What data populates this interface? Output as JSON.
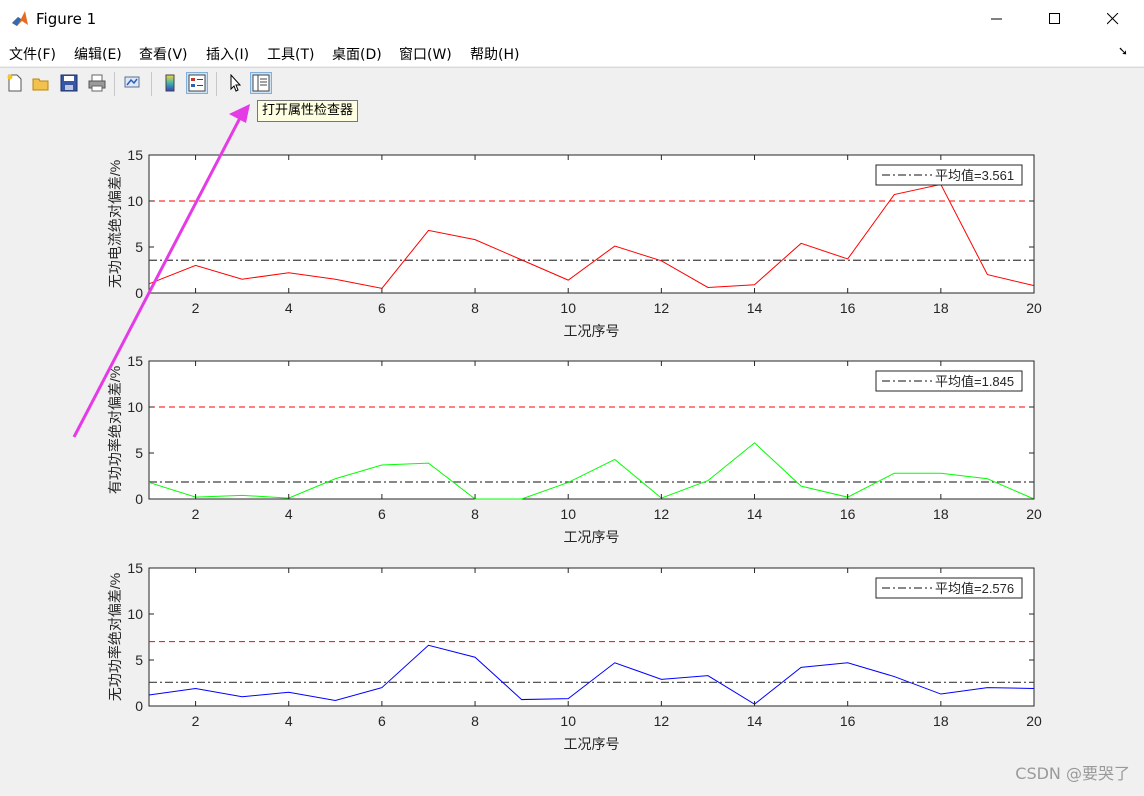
{
  "window": {
    "title": "Figure 1"
  },
  "menus": [
    "文件(F)",
    "编辑(E)",
    "查看(V)",
    "插入(I)",
    "工具(T)",
    "桌面(D)",
    "窗口(W)",
    "帮助(H)"
  ],
  "toolbar": {
    "buttons": [
      "new-figure-icon",
      "open-file-icon",
      "save-icon",
      "print-icon",
      "link-plot-icon",
      "colorbar-icon",
      "legend-icon",
      "pointer-icon",
      "property-inspector-icon"
    ],
    "tooltip": "打开属性检查器"
  },
  "watermark": "CSDN @要哭了",
  "colors": {
    "threshold": "#ff0000",
    "mean": "#404040"
  },
  "chart_data": [
    {
      "type": "line",
      "x": [
        1,
        2,
        3,
        4,
        5,
        6,
        7,
        8,
        9,
        10,
        11,
        12,
        13,
        14,
        15,
        16,
        17,
        18,
        19,
        20
      ],
      "series": [
        {
          "values": [
            1.0,
            3.0,
            1.5,
            2.2,
            1.5,
            0.5,
            6.8,
            5.8,
            3.6,
            1.4,
            5.1,
            3.5,
            0.6,
            0.9,
            5.4,
            3.7,
            10.7,
            11.8,
            2.0,
            0.8
          ],
          "color": "#ff0000"
        }
      ],
      "threshold": 10,
      "mean": 3.561,
      "legend": "平均值=3.561",
      "xlabel": "工况序号",
      "ylabel": "无功电流绝对偏差/%",
      "xlim": [
        1,
        20
      ],
      "ylim": [
        0,
        15
      ],
      "xticks": [
        2,
        4,
        6,
        8,
        10,
        12,
        14,
        16,
        18,
        20
      ],
      "yticks": [
        0,
        5,
        10,
        15
      ],
      "legend_position": "top-right"
    },
    {
      "type": "line",
      "x": [
        1,
        2,
        3,
        4,
        5,
        6,
        7,
        8,
        9,
        10,
        11,
        12,
        13,
        14,
        15,
        16,
        17,
        18,
        19,
        20
      ],
      "series": [
        {
          "values": [
            1.8,
            0.2,
            0.4,
            0.1,
            2.2,
            3.7,
            3.9,
            0.0,
            0.0,
            1.8,
            4.3,
            0.1,
            2.0,
            6.1,
            1.4,
            0.2,
            2.8,
            2.8,
            2.2,
            0.0
          ],
          "color": "#00ff00"
        }
      ],
      "threshold": 10,
      "mean": 1.845,
      "legend": "平均值=1.845",
      "xlabel": "工况序号",
      "ylabel": "有功功率绝对偏差/%",
      "xlim": [
        1,
        20
      ],
      "ylim": [
        0,
        15
      ],
      "xticks": [
        2,
        4,
        6,
        8,
        10,
        12,
        14,
        16,
        18,
        20
      ],
      "yticks": [
        0,
        5,
        10,
        15
      ],
      "legend_position": "top-right"
    },
    {
      "type": "line",
      "x": [
        1,
        2,
        3,
        4,
        5,
        6,
        7,
        8,
        9,
        10,
        11,
        12,
        13,
        14,
        15,
        16,
        17,
        18,
        19,
        20
      ],
      "series": [
        {
          "values": [
            1.2,
            1.9,
            1.0,
            1.5,
            0.6,
            2.0,
            6.6,
            5.3,
            0.7,
            0.8,
            4.7,
            2.9,
            3.3,
            0.2,
            4.2,
            4.7,
            3.2,
            1.3,
            2.0,
            1.9
          ],
          "color": "#0000ff"
        }
      ],
      "threshold": 7,
      "mean": 2.576,
      "legend": "平均值=2.576",
      "xlabel": "工况序号",
      "ylabel": "无功功率绝对偏差/%",
      "xlim": [
        1,
        20
      ],
      "ylim": [
        0,
        15
      ],
      "xticks": [
        2,
        4,
        6,
        8,
        10,
        12,
        14,
        16,
        18,
        20
      ],
      "yticks": [
        0,
        5,
        10,
        15
      ],
      "legend_position": "top-right"
    }
  ]
}
